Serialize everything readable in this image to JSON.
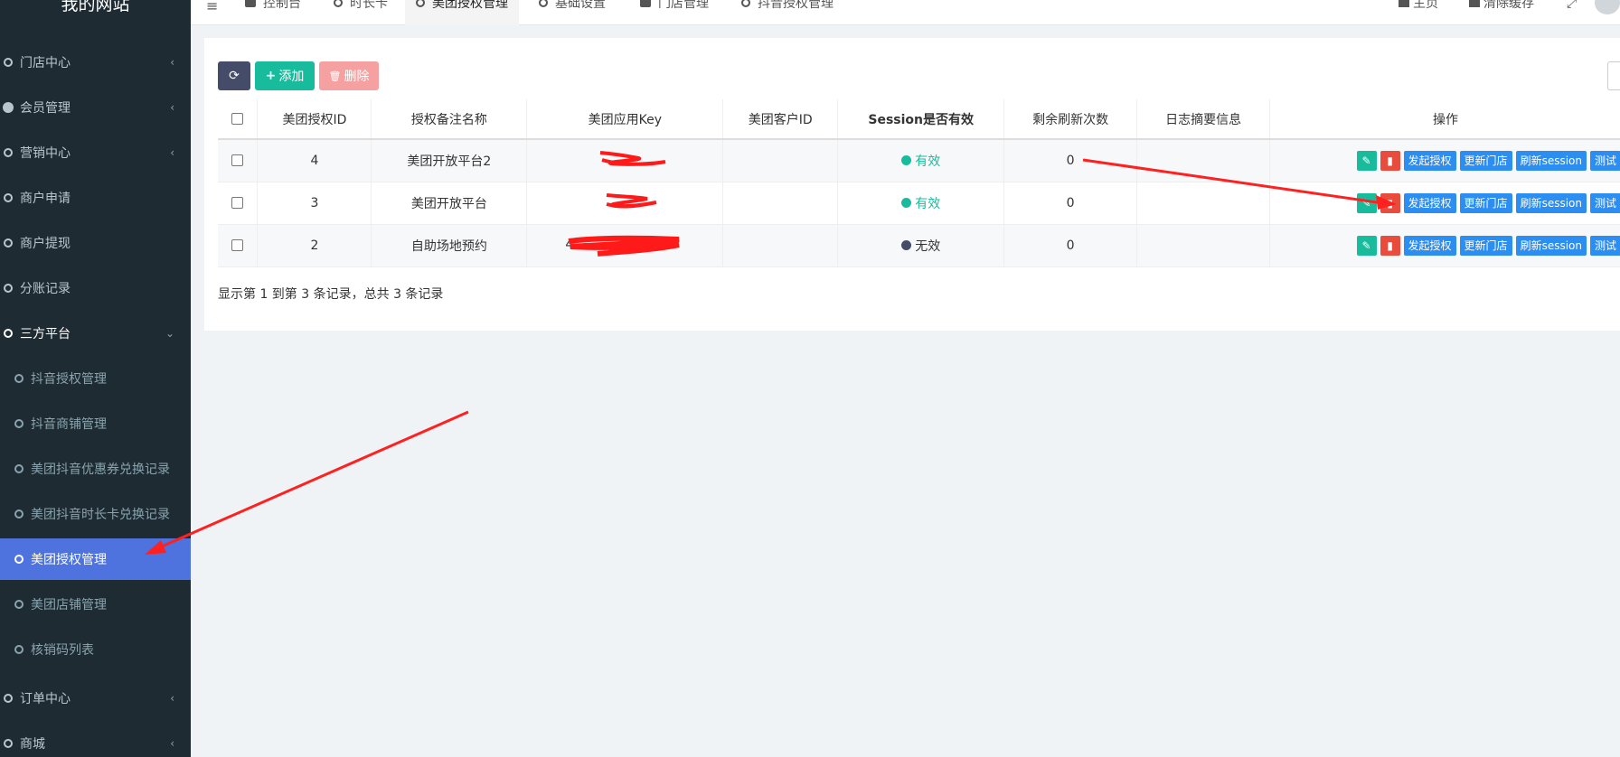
{
  "brand": "我的网站",
  "sidebar": {
    "items": [
      {
        "label": "门店中心",
        "caret": "‹"
      },
      {
        "label": "会员管理",
        "caret": "‹"
      },
      {
        "label": "营销中心",
        "caret": "‹"
      },
      {
        "label": "商户申请"
      },
      {
        "label": "商户提现"
      },
      {
        "label": "分账记录"
      },
      {
        "label": "三方平台",
        "caret": "⌄"
      }
    ],
    "sub_items": [
      {
        "label": "抖音授权管理"
      },
      {
        "label": "抖音商铺管理"
      },
      {
        "label": "美团抖音优惠券兑换记录"
      },
      {
        "label": "美团抖音时长卡兑换记录"
      },
      {
        "label": "美团授权管理"
      },
      {
        "label": "美团店铺管理"
      },
      {
        "label": "核销码列表"
      }
    ],
    "bottom_items": [
      {
        "label": "订单中心",
        "caret": "‹"
      },
      {
        "label": "商城",
        "caret": "‹"
      }
    ]
  },
  "topnav": {
    "tabs": [
      {
        "label": "控制台"
      },
      {
        "label": "时长卡"
      },
      {
        "label": "美团授权管理"
      },
      {
        "label": "基础设置"
      },
      {
        "label": "门店管理"
      },
      {
        "label": "抖音授权管理"
      }
    ],
    "home": "主页",
    "clear_cache": "清除缓存"
  },
  "toolbar": {
    "add": "添加",
    "delete": "删除",
    "plus": "+",
    "trash": "🗑",
    "refresh": "⟳"
  },
  "table": {
    "headers": [
      "美团授权ID",
      "授权备注名称",
      "美团应用Key",
      "美团客户ID",
      "Session是否有效",
      "剩余刷新次数",
      "日志摘要信息",
      "操作"
    ],
    "rows": [
      {
        "id": "4",
        "name": "美团开放平台2",
        "key": "",
        "client_id": "",
        "status": "有效",
        "status_type": "valid",
        "remaining": "0",
        "log": ""
      },
      {
        "id": "3",
        "name": "美团开放平台",
        "key": "",
        "client_id": "",
        "status": "有效",
        "status_type": "valid",
        "remaining": "0",
        "log": ""
      },
      {
        "id": "2",
        "name": "自助场地预约",
        "key": "4",
        "client_id": "",
        "status": "无效",
        "status_type": "invalid",
        "remaining": "0",
        "log": ""
      }
    ],
    "actions": {
      "authorize": "发起授权",
      "update_store": "更新门店",
      "refresh_session": "刷新session",
      "test": "测试"
    }
  },
  "pager": "显示第 1 到第 3 条记录，总共 3 条记录",
  "colors": {
    "sidebar_bg": "#1f2b32",
    "active": "#4e73df",
    "success": "#18bc9c",
    "danger": "#e74c3c",
    "primary": "#2c8ef0",
    "annotation": "#ff2020"
  }
}
